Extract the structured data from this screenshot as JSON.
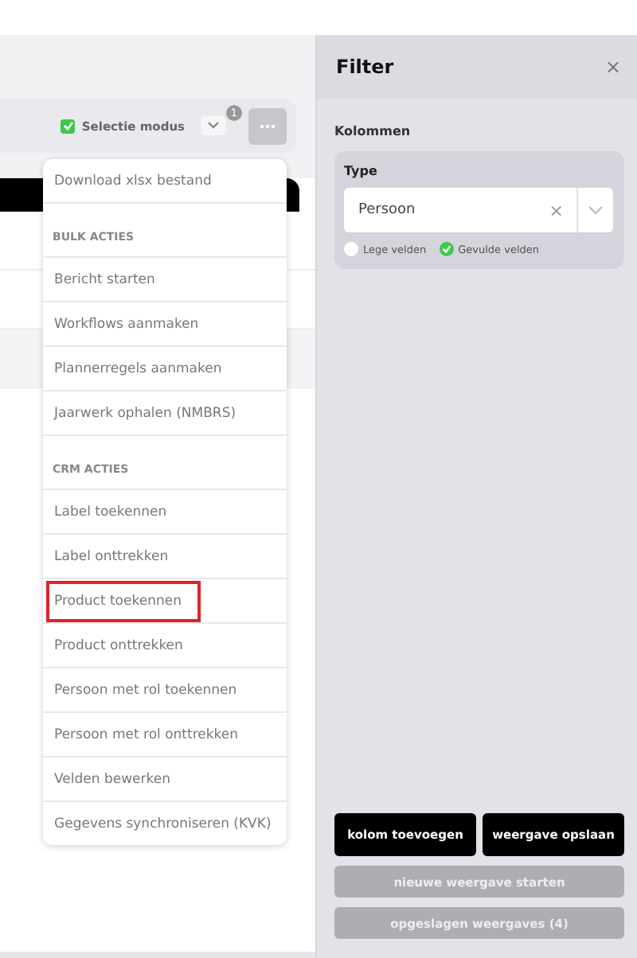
{
  "toolbar": {
    "selection_mode": {
      "label": "Selectie modus",
      "checked": true
    },
    "badge": "1"
  },
  "menu": {
    "items": [
      {
        "kind": "action",
        "label": "Download xlsx bestand",
        "highlighted": false
      },
      {
        "kind": "header",
        "label": "BULK ACTIES"
      },
      {
        "kind": "action",
        "label": "Bericht starten",
        "highlighted": false
      },
      {
        "kind": "action",
        "label": "Workflows aanmaken",
        "highlighted": false
      },
      {
        "kind": "action",
        "label": "Plannerregels aanmaken",
        "highlighted": false
      },
      {
        "kind": "action",
        "label": "Jaarwerk ophalen (NMBRS)",
        "highlighted": false
      },
      {
        "kind": "header",
        "label": "CRM ACTIES"
      },
      {
        "kind": "action",
        "label": "Label toekennen",
        "highlighted": false
      },
      {
        "kind": "action",
        "label": "Label onttrekken",
        "highlighted": false
      },
      {
        "kind": "action",
        "label": "Product toekennen",
        "highlighted": true
      },
      {
        "kind": "action",
        "label": "Product onttrekken",
        "highlighted": false
      },
      {
        "kind": "action",
        "label": "Persoon met rol toekennen",
        "highlighted": false
      },
      {
        "kind": "action",
        "label": "Persoon met rol onttrekken",
        "highlighted": false
      },
      {
        "kind": "action",
        "label": "Velden bewerken",
        "highlighted": false
      },
      {
        "kind": "action",
        "label": "Gegevens synchroniseren (KVK)",
        "highlighted": false
      }
    ]
  },
  "filter": {
    "title": "Filter",
    "close": "×",
    "section": "Kolommen",
    "field": {
      "label": "Type",
      "value": "Persoon",
      "clear": "×"
    },
    "options": [
      {
        "label": "Lege velden",
        "checked": false
      },
      {
        "label": "Gevulde velden",
        "checked": true
      }
    ]
  },
  "buttons": [
    {
      "kind": "primary",
      "label": "kolom toevoegen"
    },
    {
      "kind": "primary",
      "label": "weergave opslaan"
    },
    {
      "kind": "secondary",
      "label": "nieuwe weergave starten"
    },
    {
      "kind": "secondary",
      "label": "opgeslagen weergaves (4)"
    }
  ]
}
